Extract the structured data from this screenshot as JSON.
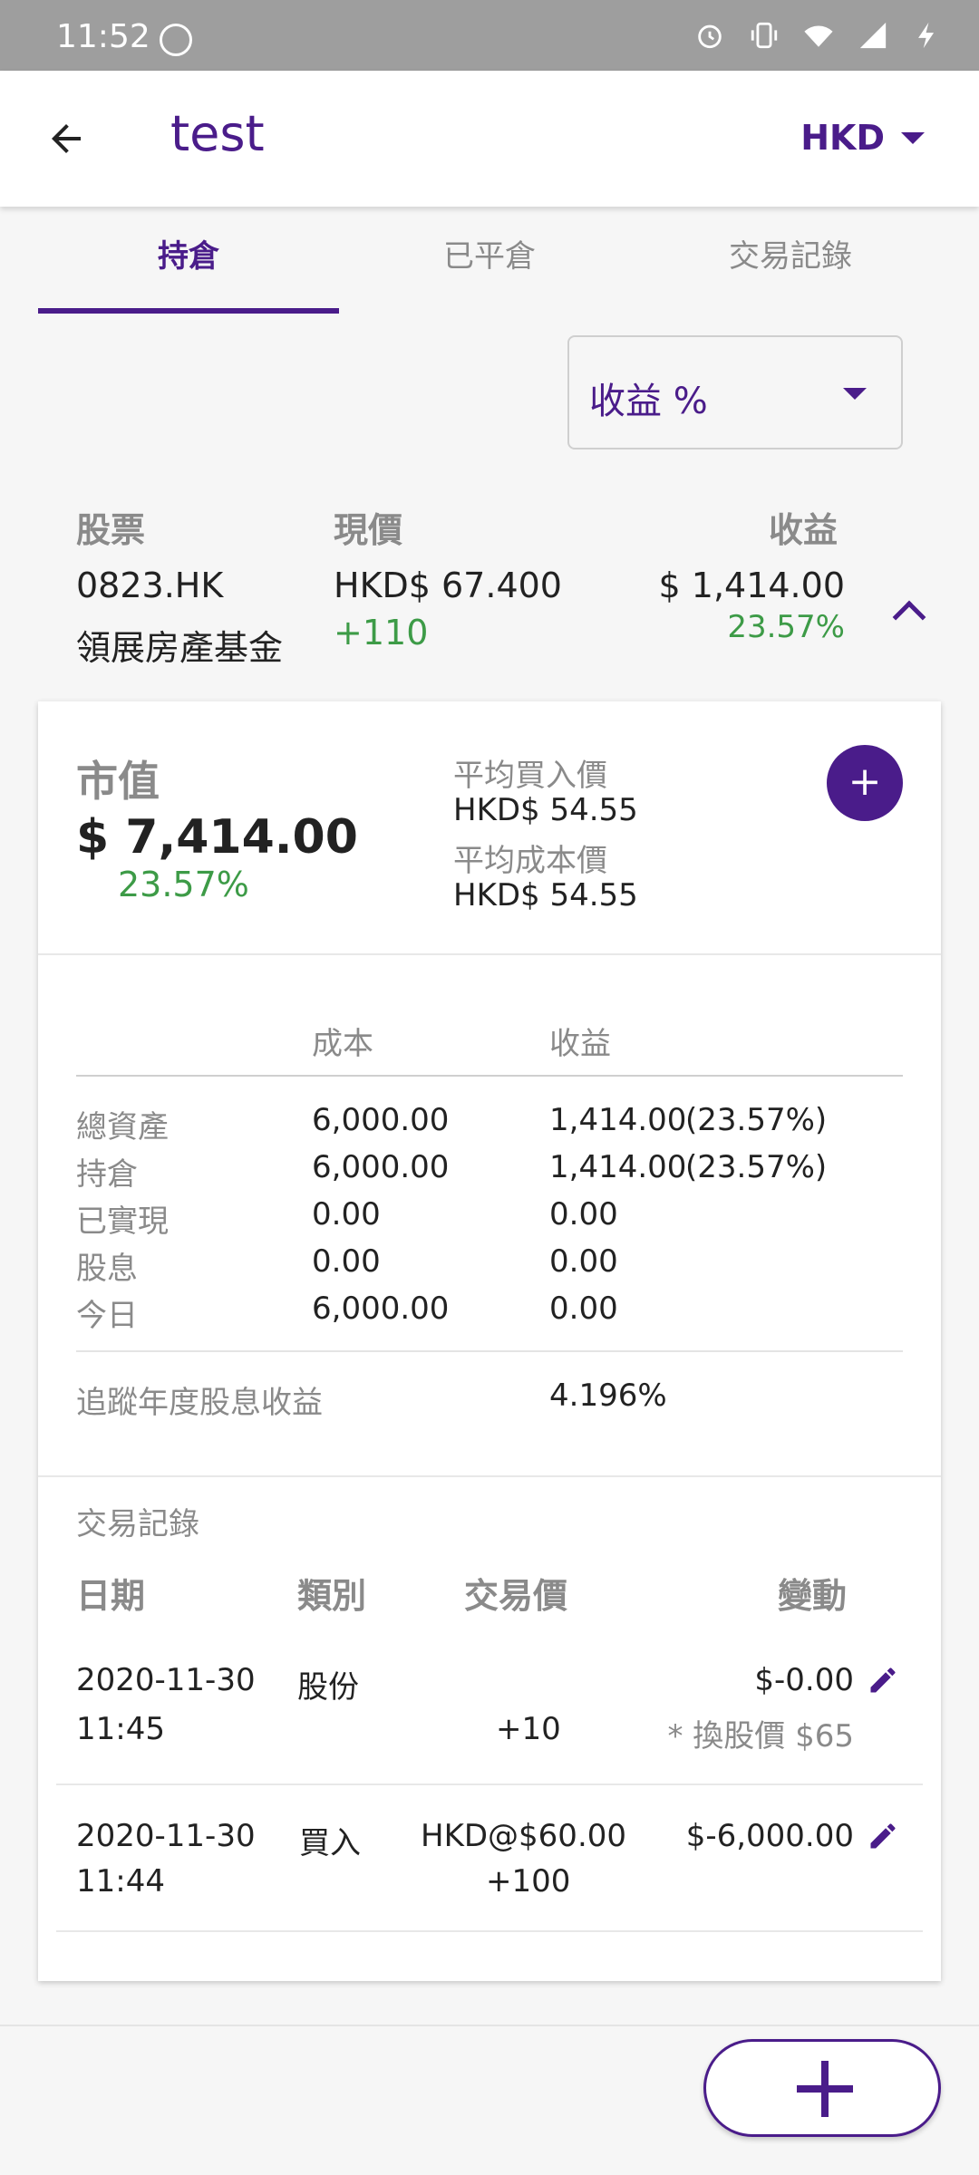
{
  "status_bar": {
    "time": "11:52"
  },
  "app_bar": {
    "title": "test",
    "currency": "HKD"
  },
  "tabs": [
    {
      "label": "持倉"
    },
    {
      "label": "已平倉"
    },
    {
      "label": "交易記錄"
    }
  ],
  "sort_select": {
    "value": "收益 %"
  },
  "list_header": {
    "stock": "股票",
    "price": "現價",
    "gain": "收益"
  },
  "stock": {
    "code": "0823.HK",
    "name": "領展房產基金",
    "price": "HKD$ 67.400",
    "quantity_change": "+110",
    "gain": "$ 1,414.00",
    "gain_pct": "23.57%"
  },
  "detail": {
    "market_value_label": "市值",
    "market_value": "$ 7,414.00",
    "market_value_pct": "23.57%",
    "avg_buy_label": "平均買入價",
    "avg_buy": "HKD$ 54.55",
    "avg_cost_label": "平均成本價",
    "avg_cost": "HKD$ 54.55",
    "add_label": "+",
    "table_header": {
      "cost": "成本",
      "gain": "收益"
    },
    "rows": [
      {
        "label": "總資產",
        "cost": "6,000.00",
        "gain": "1,414.00",
        "pct": "(23.57%)"
      },
      {
        "label": "持倉",
        "cost": "6,000.00",
        "gain": "1,414.00",
        "pct": "(23.57%)"
      },
      {
        "label": "已實現",
        "cost": "0.00",
        "gain": "0.00",
        "pct": ""
      },
      {
        "label": "股息",
        "cost": "0.00",
        "gain": "0.00",
        "pct": ""
      },
      {
        "label": "今日",
        "cost": "6,000.00",
        "gain": "0.00",
        "pct": ""
      }
    ],
    "dividend_yield_label": "追蹤年度股息收益",
    "dividend_yield": "4.196%"
  },
  "transactions": {
    "section_label": "交易記錄",
    "header": {
      "date": "日期",
      "type": "類別",
      "price": "交易價",
      "change": "變動"
    },
    "items": [
      {
        "date": "2020-11-30",
        "time": "11:45",
        "type": "股份",
        "price": "",
        "qty": "+10",
        "change": "$-0.00",
        "note": "* 換股價 $65"
      },
      {
        "date": "2020-11-30",
        "time": "11:44",
        "type": "買入",
        "price": "HKD@$60.00",
        "qty": "+100",
        "change": "$-6,000.00",
        "note": ""
      }
    ]
  },
  "colors": {
    "accent": "#4a1c8a",
    "positive": "#3d9b47",
    "status_bar": "#9e9e9e"
  }
}
